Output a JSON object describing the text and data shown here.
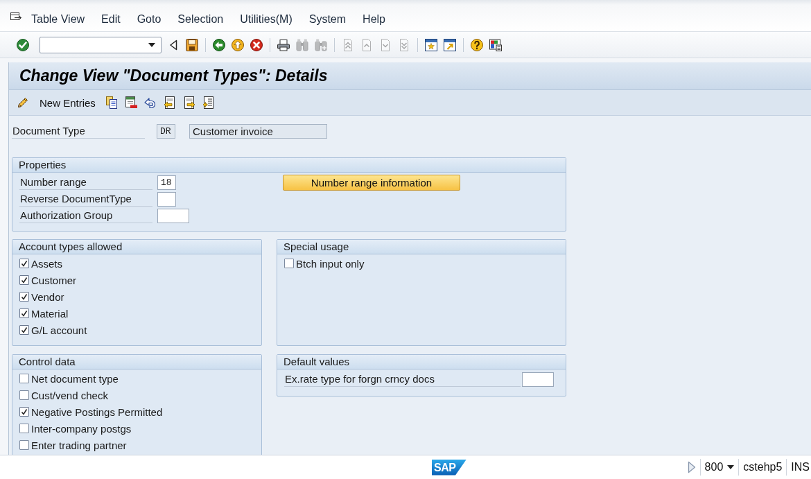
{
  "menu_bar": {
    "items": [
      {
        "label": "Table View"
      },
      {
        "label": "Edit"
      },
      {
        "label": "Goto"
      },
      {
        "label": "Selection"
      },
      {
        "label": "Utilities(M)"
      },
      {
        "label": "System"
      },
      {
        "label": "Help"
      }
    ]
  },
  "toolbar": {
    "groups": [
      {
        "items": [
          {
            "kind": "enter",
            "disabled": false
          },
          {
            "kind": "command_field",
            "disabled": false
          },
          {
            "kind": "hide",
            "disabled": false
          },
          {
            "kind": "save",
            "disabled": false
          }
        ]
      },
      {
        "items": [
          {
            "kind": "back",
            "disabled": false
          },
          {
            "kind": "exit",
            "disabled": false
          },
          {
            "kind": "cancel",
            "disabled": false
          }
        ]
      },
      {
        "items": [
          {
            "kind": "print",
            "disabled": false
          },
          {
            "kind": "find",
            "disabled": true
          },
          {
            "kind": "find_next",
            "disabled": true
          }
        ]
      },
      {
        "items": [
          {
            "kind": "first_page",
            "disabled": true
          },
          {
            "kind": "previous_page",
            "disabled": true
          },
          {
            "kind": "next_page",
            "disabled": true
          },
          {
            "kind": "last_page",
            "disabled": true
          }
        ]
      },
      {
        "items": [
          {
            "kind": "new_session",
            "disabled": false
          },
          {
            "kind": "shortcut",
            "disabled": false
          }
        ]
      },
      {
        "items": [
          {
            "kind": "help",
            "disabled": false
          },
          {
            "kind": "layout",
            "disabled": false
          }
        ]
      }
    ]
  },
  "title": "Change View \"Document Types\": Details",
  "app_toolbar": {
    "buttons": [
      {
        "kind": "new_entries",
        "label": "New Entries"
      },
      {
        "kind": "copy"
      },
      {
        "kind": "delete"
      },
      {
        "kind": "undo"
      },
      {
        "kind": "previous_entry"
      },
      {
        "kind": "next_entry"
      },
      {
        "kind": "other_entry"
      }
    ]
  },
  "document_type": {
    "label": "Document Type",
    "code": "DR",
    "description": "Customer invoice"
  },
  "properties": {
    "title": "Properties",
    "fields": [
      {
        "label": "Number range",
        "value": "18"
      },
      {
        "label": "Reverse DocumentType"
      },
      {
        "label": "Authorization Group"
      }
    ],
    "button": {
      "label": "Number range information"
    }
  },
  "account_types": {
    "title": "Account types allowed",
    "options": [
      {
        "label": "Assets",
        "checked": true
      },
      {
        "label": "Customer",
        "checked": true
      },
      {
        "label": "Vendor",
        "checked": true
      },
      {
        "label": "Material",
        "checked": true
      },
      {
        "label": "G/L account",
        "checked": true
      }
    ]
  },
  "special_usage": {
    "title": "Special usage",
    "options": [
      {
        "label": "Btch input only",
        "checked": false
      }
    ]
  },
  "control_data": {
    "title": "Control data",
    "options": [
      {
        "label": "Net document type",
        "checked": false
      },
      {
        "label": "Cust/vend check",
        "checked": false
      },
      {
        "label": "Negative Postings Permitted",
        "checked": true
      },
      {
        "label": "Inter-company postgs",
        "checked": false
      },
      {
        "label": "Enter trading partner",
        "checked": false
      }
    ]
  },
  "default_values": {
    "title": "Default values",
    "fields": [
      {
        "label": "Ex.rate type for forgn crncy docs"
      }
    ]
  },
  "status_bar": {
    "logo": "SAP",
    "client": "800",
    "user": "cstehp5",
    "mode": "INS"
  }
}
